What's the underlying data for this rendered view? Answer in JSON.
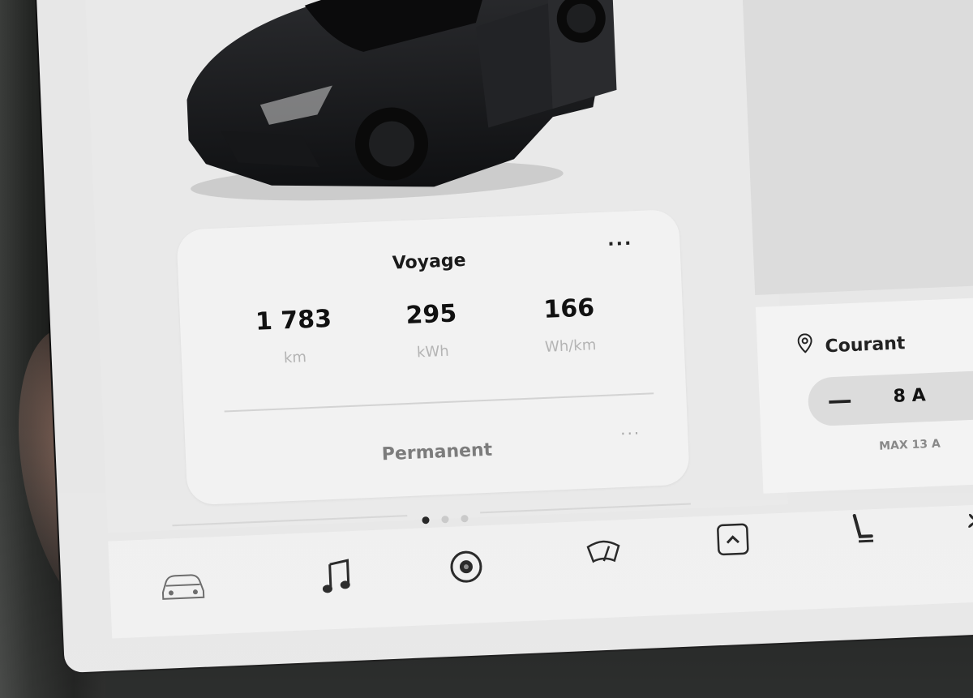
{
  "trip_card": {
    "title": "Voyage",
    "more_label": "···",
    "stats": [
      {
        "value": "1 783",
        "unit": "km"
      },
      {
        "value": "295",
        "unit": "kWh"
      },
      {
        "value": "166",
        "unit": "Wh/km"
      }
    ],
    "second_title": "Permanent",
    "second_more_label": "···"
  },
  "pager": {
    "count": 3,
    "active": 0
  },
  "charging": {
    "label": "Courant",
    "minus_label": "—",
    "value": "8 A",
    "max_label": "MAX 13 A"
  },
  "dock": {
    "items": [
      "car-icon",
      "music-icon",
      "camera-icon",
      "wiper-icon",
      "chevron-up-icon",
      "seat-heater-icon",
      "fan-icon"
    ]
  },
  "colors": {
    "screen_bg": "#e7e7e7",
    "card_bg": "#f2f2f2",
    "car": "#1c1d1f"
  }
}
